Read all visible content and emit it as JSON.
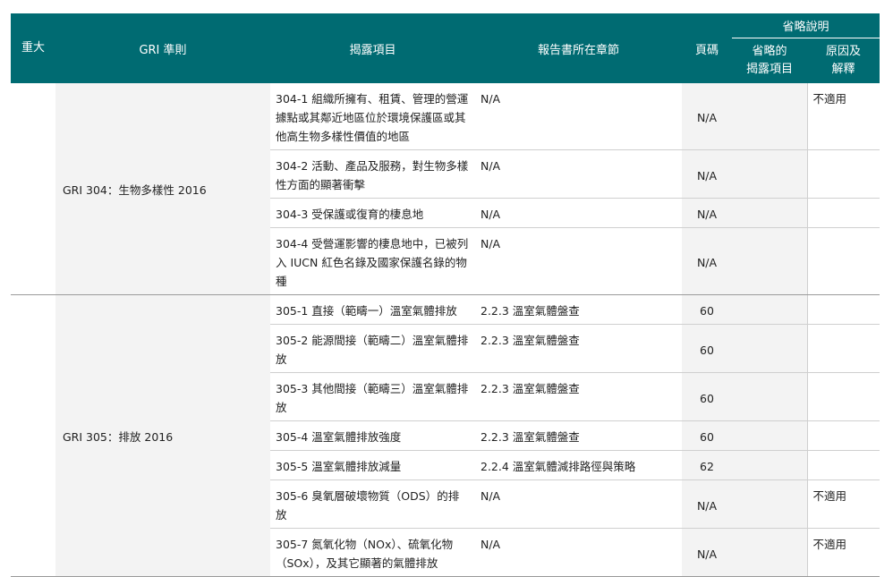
{
  "header": {
    "material": "重大",
    "gri_standard": "GRI 準則",
    "disclosure": "揭露項目",
    "report_section": "報告書所在章節",
    "page": "頁碼",
    "omission": "省略說明",
    "omitted_disclosure": "省略的\n揭露項目",
    "reason": "原因及\n解釋"
  },
  "groups": [
    {
      "standard": "GRI 304：生物多樣性 2016",
      "rows": [
        {
          "disclosure": "304-1 組織所擁有、租賃、管理的營運據點或其鄰近地區位於環境保護區或其他高生物多樣性價值的地區",
          "section": "N/A",
          "page": "N/A",
          "omitted": "",
          "reason": "不適用"
        },
        {
          "disclosure": "304-2 活動、產品及服務，對生物多樣性方面的顯著衝擊",
          "section": "N/A",
          "page": "N/A",
          "omitted": "",
          "reason": ""
        },
        {
          "disclosure": "304-3 受保護或復育的棲息地",
          "section": "N/A",
          "page": "N/A",
          "omitted": "",
          "reason": ""
        },
        {
          "disclosure": "304-4 受營運影響的棲息地中，已被列入 IUCN 紅色名錄及國家保護名錄的物種",
          "section": "N/A",
          "page": "N/A",
          "omitted": "",
          "reason": ""
        }
      ]
    },
    {
      "standard": "GRI 305：排放 2016",
      "rows": [
        {
          "disclosure": "305-1 直接（範疇一）溫室氣體排放",
          "section": "2.2.3 溫室氣體盤查",
          "page": "60",
          "omitted": "",
          "reason": ""
        },
        {
          "disclosure": "305-2 能源間接（範疇二）溫室氣體排放",
          "section": "2.2.3 溫室氣體盤查",
          "page": "60",
          "omitted": "",
          "reason": ""
        },
        {
          "disclosure": "305-3 其他間接（範疇三）溫室氣體排放",
          "section": "2.2.3 溫室氣體盤查",
          "page": "60",
          "omitted": "",
          "reason": ""
        },
        {
          "disclosure": "305-4 溫室氣體排放強度",
          "section": "2.2.3 溫室氣體盤查",
          "page": "60",
          "omitted": "",
          "reason": ""
        },
        {
          "disclosure": "305-5 溫室氣體排放減量",
          "section": "2.2.4 溫室氣體減排路徑與策略",
          "page": "62",
          "omitted": "",
          "reason": ""
        },
        {
          "disclosure": "305-6 臭氧層破壞物質（ODS）的排放",
          "section": "N/A",
          "page": "N/A",
          "omitted": "",
          "reason": "不適用"
        },
        {
          "disclosure": "305-7 氮氧化物（NOx）、硫氧化物（SOx），及其它顯著的氣體排放",
          "section": "N/A",
          "page": "N/A",
          "omitted": "",
          "reason": "不適用"
        }
      ]
    }
  ]
}
